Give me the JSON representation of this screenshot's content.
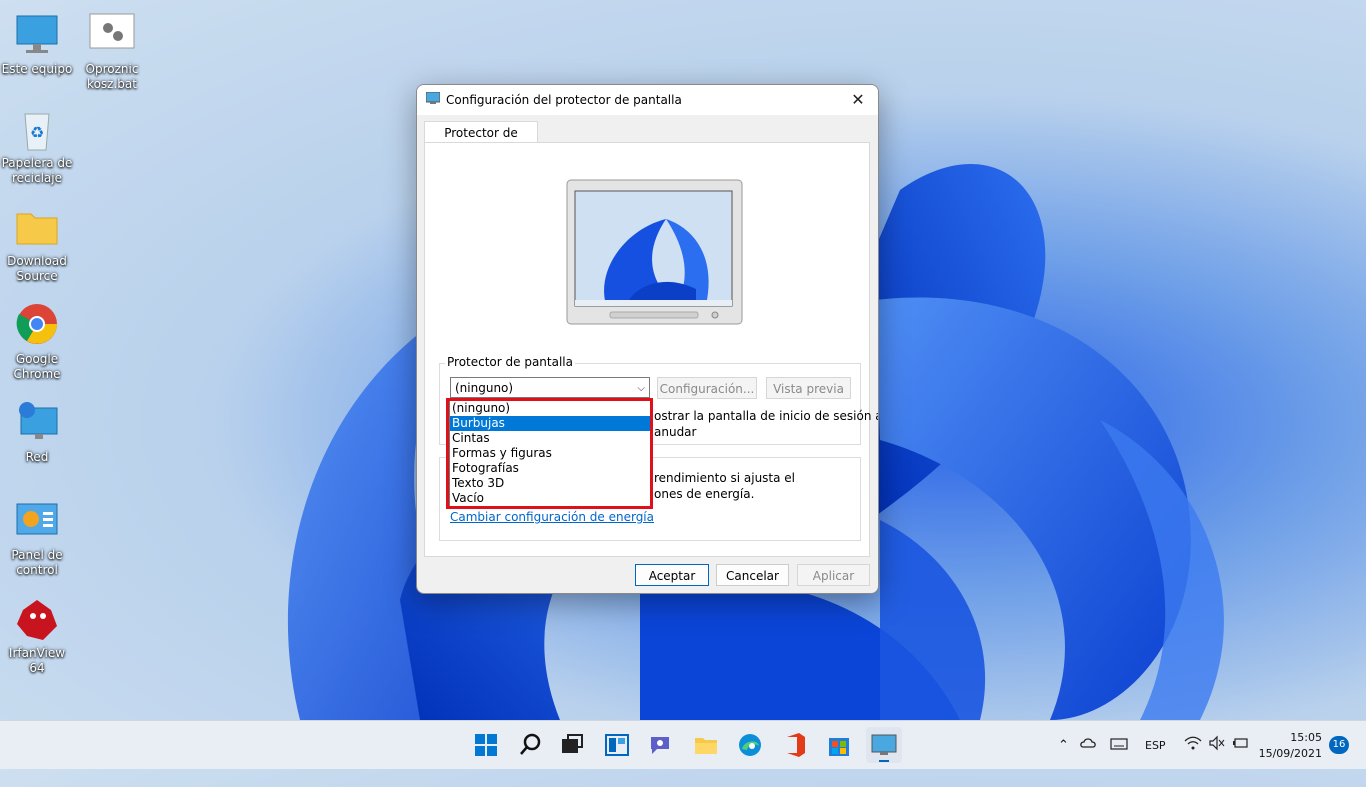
{
  "desktop": {
    "icons": [
      {
        "label": "Este equipo"
      },
      {
        "label": "Oproznic kosz.bat"
      },
      {
        "label": "Papelera de reciclaje"
      },
      {
        "label": "Download Source"
      },
      {
        "label": "Google Chrome"
      },
      {
        "label": "Red"
      },
      {
        "label": "Panel de control"
      },
      {
        "label": "IrfanView 64"
      }
    ]
  },
  "dialog": {
    "title": "Configuración del protector de pantalla",
    "close_glyph": "✕",
    "tab_label": "Protector de pantalla",
    "group_title": "Protector de pantalla",
    "selected_value": "(ninguno)",
    "config_button": "Configuración...",
    "preview_button": "Vista previa",
    "resume_text_line1": "ostrar la pantalla de inicio de sesión al",
    "resume_text_line2": "anudar",
    "power_text_line1": "rendimiento si ajusta el",
    "power_text_line2": "ones de energía.",
    "power_link": "Cambiar configuración de energía",
    "ok_button": "Aceptar",
    "cancel_button": "Cancelar",
    "apply_button": "Aplicar",
    "options": [
      {
        "label": "(ninguno)"
      },
      {
        "label": "Burbujas"
      },
      {
        "label": "Cintas"
      },
      {
        "label": "Formas y figuras"
      },
      {
        "label": "Fotografías"
      },
      {
        "label": "Texto 3D"
      },
      {
        "label": "Vacío"
      }
    ],
    "highlighted_option": "Burbujas"
  },
  "taskbar": {
    "language": "ESP",
    "time": "15:05",
    "date": "15/09/2021",
    "notification_count": "16"
  },
  "colors": {
    "accent": "#0078d7",
    "highlight_box": "#e0101a",
    "link": "#0066cc"
  }
}
